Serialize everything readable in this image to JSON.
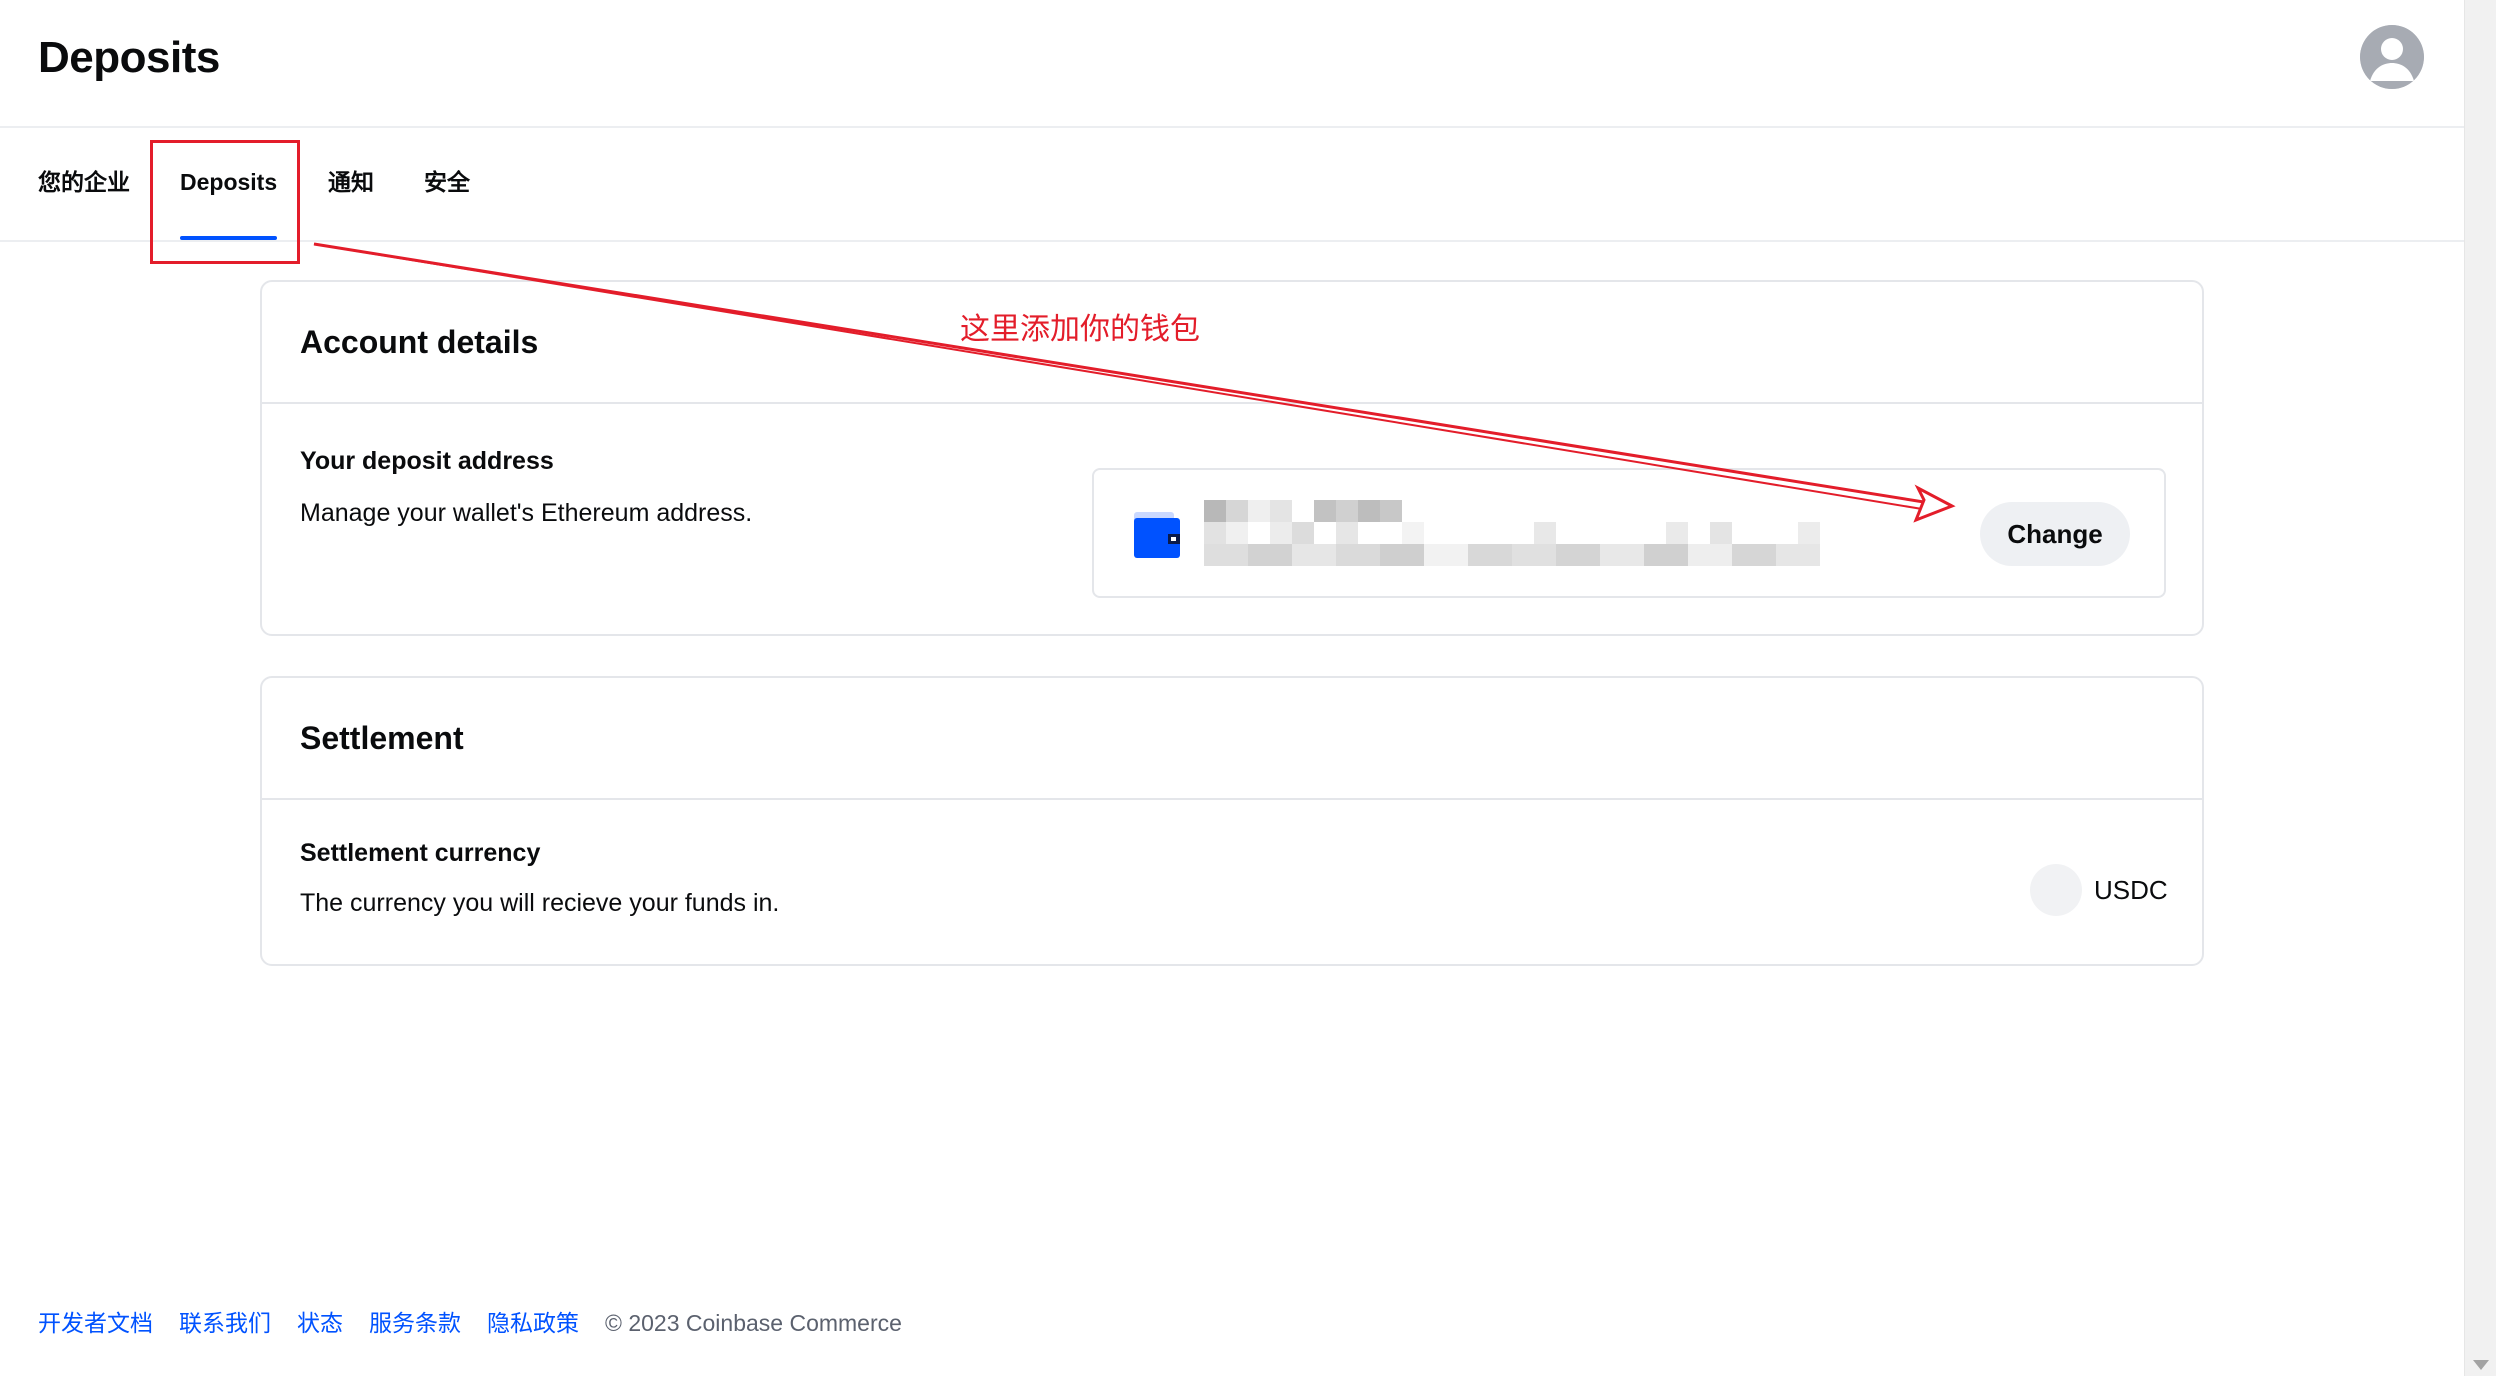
{
  "header": {
    "title": "Deposits",
    "avatar_icon": "user-avatar-icon"
  },
  "tabs": [
    {
      "label": "您的企业",
      "active": false
    },
    {
      "label": "Deposits",
      "active": true
    },
    {
      "label": "通知",
      "active": false
    },
    {
      "label": "安全",
      "active": false
    }
  ],
  "account_details": {
    "title": "Account details",
    "deposit_label": "Your deposit address",
    "deposit_desc": "Manage your wallet's Ethereum address.",
    "wallet_icon": "wallet-icon",
    "change_label": "Change"
  },
  "settlement": {
    "title": "Settlement",
    "currency_label": "Settlement currency",
    "currency_desc": "The currency you will recieve your funds in.",
    "currency_value": "USDC"
  },
  "annotation": {
    "text": "这里添加你的钱包",
    "color": "#e31d2a"
  },
  "footer": {
    "links": [
      "开发者文档",
      "联系我们",
      "状态",
      "服务条款",
      "隐私政策"
    ],
    "copyright": "© 2023 Coinbase Commerce"
  },
  "colors": {
    "accent": "#0052ff",
    "annotation": "#e31d2a"
  }
}
